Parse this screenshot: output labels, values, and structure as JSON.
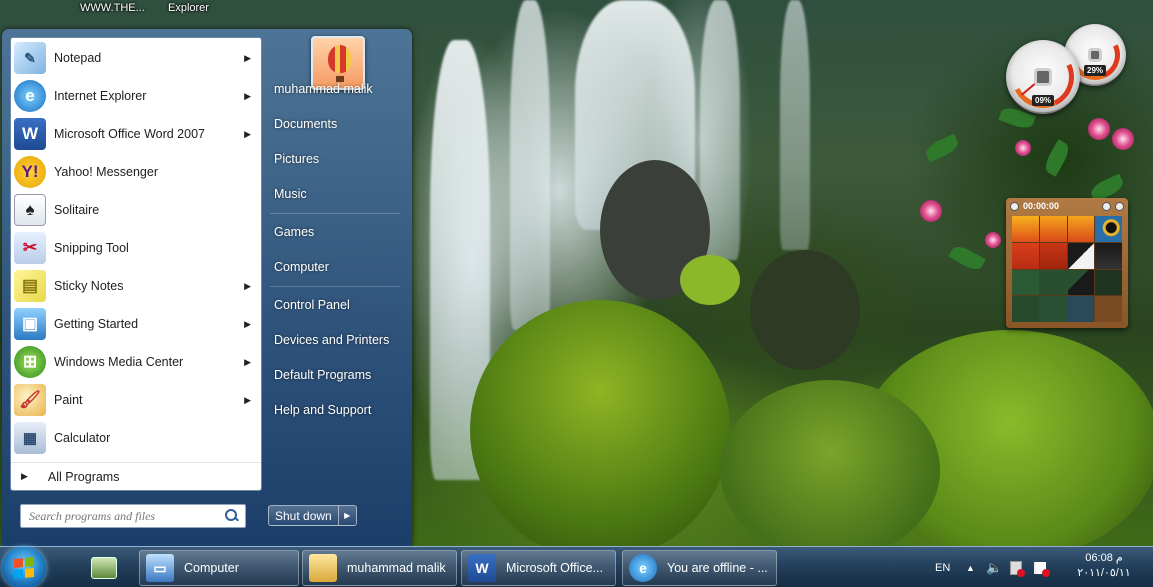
{
  "desktop": {
    "labels": [
      "WWW.THE...",
      "Explorer"
    ]
  },
  "gadgets": {
    "cpu_meter": {
      "cpu_percent": "09%",
      "ram_percent": "29%"
    },
    "puzzle": {
      "timer": "00:00:00"
    }
  },
  "start_menu": {
    "user_name": "muhammad malik",
    "programs": [
      {
        "label": "Notepad",
        "icon": "notepad-icon",
        "submenu": true
      },
      {
        "label": "Internet Explorer",
        "icon": "internet-explorer-icon",
        "submenu": true
      },
      {
        "label": "Microsoft Office Word 2007",
        "icon": "word-icon",
        "submenu": true
      },
      {
        "label": "Yahoo! Messenger",
        "icon": "yahoo-messenger-icon",
        "submenu": false
      },
      {
        "label": "Solitaire",
        "icon": "solitaire-icon",
        "submenu": false
      },
      {
        "label": "Snipping Tool",
        "icon": "snipping-tool-icon",
        "submenu": false
      },
      {
        "label": "Sticky Notes",
        "icon": "sticky-notes-icon",
        "submenu": true
      },
      {
        "label": "Getting Started",
        "icon": "getting-started-icon",
        "submenu": true
      },
      {
        "label": "Windows Media Center",
        "icon": "media-center-icon",
        "submenu": true
      },
      {
        "label": "Paint",
        "icon": "paint-icon",
        "submenu": true
      },
      {
        "label": "Calculator",
        "icon": "calculator-icon",
        "submenu": false
      }
    ],
    "all_programs": "All Programs",
    "search_placeholder": "Search programs and files",
    "right_links": [
      "Documents",
      "Pictures",
      "Music",
      "Games",
      "Computer",
      "Control Panel",
      "Devices and Printers",
      "Default Programs",
      "Help and Support"
    ],
    "shutdown_label": "Shut down"
  },
  "taskbar": {
    "buttons": [
      {
        "label": "Computer",
        "icon": "computer-icon"
      },
      {
        "label": "muhammad malik",
        "icon": "folder-icon"
      },
      {
        "label": "Microsoft Office...",
        "icon": "word-icon"
      },
      {
        "label": "You are offline - ...",
        "icon": "internet-explorer-icon"
      }
    ],
    "tray": {
      "language": "EN"
    },
    "clock": {
      "time": "06:08 م",
      "date": "٢٠١١/٠٥/١١"
    }
  },
  "colors": {
    "start_menu_blue": "#24476e",
    "taskbar_blue": "#24405c",
    "accent": "#1f7bc2"
  }
}
